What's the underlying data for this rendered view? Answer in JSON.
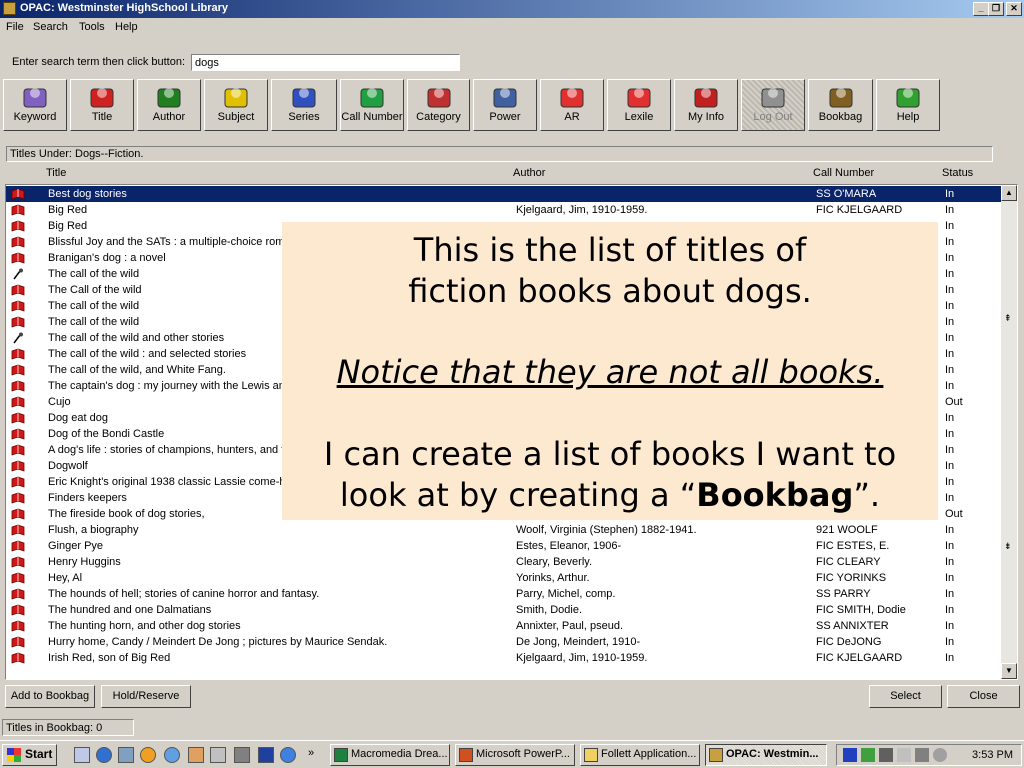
{
  "window": {
    "title": "OPAC: Westminster HighSchool Library"
  },
  "menu": [
    "File",
    "Search",
    "Tools",
    "Help"
  ],
  "search": {
    "label": "Enter search term then click button:",
    "value": "dogs"
  },
  "toolbar": [
    {
      "label": "Keyword",
      "icon": "magnifier-icon",
      "color": "#8060c0"
    },
    {
      "label": "Title",
      "icon": "title-sign-icon",
      "color": "#d02020"
    },
    {
      "label": "Author",
      "icon": "author-icon",
      "color": "#208020"
    },
    {
      "label": "Subject",
      "icon": "subject-icon",
      "color": "#e0c000"
    },
    {
      "label": "Series",
      "icon": "books-icon",
      "color": "#3050c0"
    },
    {
      "label": "Call Number",
      "icon": "call-number-icon",
      "color": "#20a040"
    },
    {
      "label": "Category",
      "icon": "category-icon",
      "color": "#c03030"
    },
    {
      "label": "Power",
      "icon": "power-icon",
      "color": "#4060a0"
    },
    {
      "label": "AR",
      "icon": "reader-icon",
      "color": "#e03030"
    },
    {
      "label": "Lexile",
      "icon": "reader-icon",
      "color": "#e03030"
    },
    {
      "label": "My Info",
      "icon": "people-icon",
      "color": "#c02020"
    },
    {
      "label": "Log Out",
      "icon": "logout-icon",
      "color": "#909090"
    },
    {
      "label": "Bookbag",
      "icon": "bookbag-icon",
      "color": "#806020"
    },
    {
      "label": "Help",
      "icon": "sos-icon",
      "color": "#30a030"
    }
  ],
  "titles_under": "Titles Under: Dogs--Fiction.",
  "columns": {
    "title": "Title",
    "author": "Author",
    "call": "Call Number",
    "status": "Status"
  },
  "rows": [
    {
      "title": "Best dog stories",
      "author": "",
      "call": "SS O'MARA",
      "status": "In",
      "icon": "book-icon",
      "selected": true
    },
    {
      "title": "Big Red",
      "author": "Kjelgaard, Jim, 1910-1959.",
      "call": "FIC KJELGAARD",
      "status": "In",
      "icon": "book-icon"
    },
    {
      "title": "Big Red",
      "author": "",
      "call": "",
      "status": "In",
      "icon": "book-icon"
    },
    {
      "title": "Blissful Joy and the SATs : a multiple-choice roman",
      "author": "",
      "call": "",
      "status": "In",
      "icon": "book-icon"
    },
    {
      "title": "Branigan's dog : a novel",
      "author": "",
      "call": "",
      "status": "In",
      "icon": "book-icon"
    },
    {
      "title": "The call of the wild",
      "author": "",
      "call": "",
      "status": "In",
      "icon": "microphone-icon"
    },
    {
      "title": "The Call of the wild",
      "author": "",
      "call": "",
      "status": "In",
      "icon": "book-icon"
    },
    {
      "title": "The call of the wild",
      "author": "",
      "call": "",
      "status": "In",
      "icon": "book-icon"
    },
    {
      "title": "The call of the wild",
      "author": "",
      "call": "",
      "status": "In",
      "icon": "book-icon"
    },
    {
      "title": "The call of the wild and other stories",
      "author": "",
      "call": "",
      "status": "In",
      "icon": "microphone-icon"
    },
    {
      "title": "The call of the wild : and selected stories",
      "author": "",
      "call": "",
      "status": "In",
      "icon": "book-icon"
    },
    {
      "title": "The call of the wild, and White Fang.",
      "author": "",
      "call": "",
      "status": "In",
      "icon": "book-icon"
    },
    {
      "title": "The captain's dog : my journey with the Lewis and",
      "author": "",
      "call": "",
      "status": "In",
      "icon": "book-icon"
    },
    {
      "title": "Cujo",
      "author": "",
      "call": "",
      "status": "Out",
      "icon": "book-icon"
    },
    {
      "title": "Dog eat dog",
      "author": "",
      "call": "",
      "status": "In",
      "icon": "book-icon"
    },
    {
      "title": "Dog of the Bondi Castle",
      "author": "",
      "call": "",
      "status": "In",
      "icon": "book-icon"
    },
    {
      "title": "A dog's life : stories of champions, hunters, and fai",
      "author": "",
      "call": "",
      "status": "In",
      "icon": "book-icon"
    },
    {
      "title": "Dogwolf",
      "author": "",
      "call": "",
      "status": "In",
      "icon": "book-icon"
    },
    {
      "title": "Eric Knight's original 1938 classic Lassie come-ho",
      "author": "",
      "call": "",
      "status": "In",
      "icon": "book-icon"
    },
    {
      "title": "Finders keepers",
      "author": "",
      "call": "",
      "status": "In",
      "icon": "book-icon"
    },
    {
      "title": "The fireside book of dog stories,",
      "author": "",
      "call": "",
      "status": "Out",
      "icon": "book-icon"
    },
    {
      "title": "Flush, a biography",
      "author": "Woolf, Virginia (Stephen) 1882-1941.",
      "call": "921 WOOLF",
      "status": "In",
      "icon": "book-icon"
    },
    {
      "title": "Ginger Pye",
      "author": "Estes, Eleanor, 1906-",
      "call": "FIC ESTES, E.",
      "status": "In",
      "icon": "book-icon"
    },
    {
      "title": "Henry Huggins",
      "author": "Cleary, Beverly.",
      "call": "FIC CLEARY",
      "status": "In",
      "icon": "book-icon"
    },
    {
      "title": "Hey, Al",
      "author": "Yorinks, Arthur.",
      "call": "FIC YORINKS",
      "status": "In",
      "icon": "book-icon"
    },
    {
      "title": "The hounds of hell; stories of canine horror and fantasy.",
      "author": "Parry, Michel, comp.",
      "call": "SS PARRY",
      "status": "In",
      "icon": "book-icon"
    },
    {
      "title": "The hundred and one Dalmatians",
      "author": "Smith, Dodie.",
      "call": "FIC SMITH, Dodie",
      "status": "In",
      "icon": "book-icon"
    },
    {
      "title": "The hunting horn, and other dog stories",
      "author": "Annixter, Paul, pseud.",
      "call": "SS ANNIXTER",
      "status": "In",
      "icon": "book-icon"
    },
    {
      "title": "Hurry home, Candy / Meindert De Jong ; pictures by Maurice Sendak.",
      "author": "De Jong, Meindert, 1910-",
      "call": "FIC DeJONG",
      "status": "In",
      "icon": "book-icon"
    },
    {
      "title": "Irish Red, son of Big Red",
      "author": "Kjelgaard, Jim, 1910-1959.",
      "call": "FIC KJELGAARD",
      "status": "In",
      "icon": "book-icon"
    }
  ],
  "callout": {
    "line1": "This is the list of titles of",
    "line2": "fiction books about dogs.",
    "line3": "Notice that they are not all books.",
    "line4": "I can create a list of books I want to",
    "line5a": "look at by creating a “",
    "line5b": "Bookbag",
    "line5c": "”."
  },
  "buttons": {
    "add": "Add to Bookbag",
    "hold": "Hold/Reserve",
    "select": "Select",
    "close": "Close"
  },
  "statusbar": {
    "bookbag": "Titles in Bookbag:  0"
  },
  "taskbar": {
    "start": "Start",
    "more": "»",
    "tasks": [
      {
        "label": "Macromedia Drea...",
        "icon": "dreamweaver-icon"
      },
      {
        "label": "Microsoft PowerP...",
        "icon": "powerpoint-icon"
      },
      {
        "label": "Follett Application...",
        "icon": "folder-icon"
      },
      {
        "label": "OPAC: Westmin...",
        "icon": "opac-icon",
        "active": true
      }
    ],
    "clock": "3:53 PM"
  },
  "colors": {
    "selected": "#0a246a",
    "callout_bg": "#fde9d0",
    "book_icon": "#d01818"
  }
}
